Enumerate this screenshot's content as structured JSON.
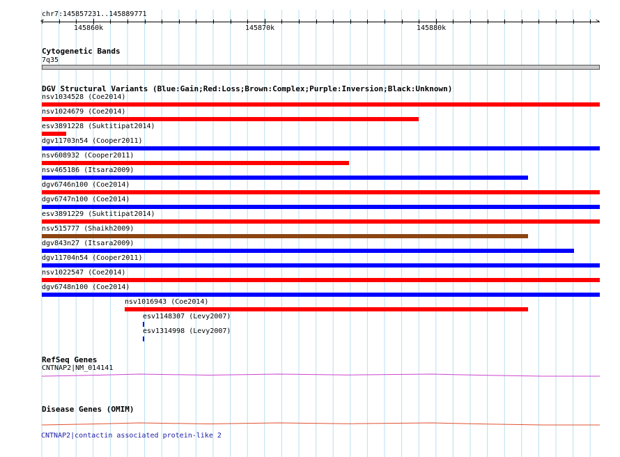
{
  "ruler": {
    "location": "chr7:145857231..145889771",
    "tick_labels": [
      "145860k",
      "145870k",
      "145880k"
    ]
  },
  "cytoband": {
    "title": "Cytogenetic Bands",
    "band": "7q35"
  },
  "dgv": {
    "title": "DGV Structural Variants (Blue:Gain;Red:Loss;Brown:Complex;Purple:Inversion;Black:Unknown)",
    "colors": {
      "gain": "#0000ff",
      "loss": "#ff0000",
      "complex": "#8b4513",
      "inversion": "#800080",
      "unknown": "#000000"
    },
    "variants": [
      {
        "label": "nsv1034528 (Coe2014)",
        "type": "loss"
      },
      {
        "label": "nsv1024679 (Coe2014)",
        "type": "loss"
      },
      {
        "label": "esv3891228 (Suktitipat2014)",
        "type": "loss"
      },
      {
        "label": "dgv11703n54 (Cooper2011)",
        "type": "gain"
      },
      {
        "label": "nsv608932 (Cooper2011)",
        "type": "loss"
      },
      {
        "label": "nsv465186 (Itsara2009)",
        "type": "gain"
      },
      {
        "label": "dgv6746n100 (Coe2014)",
        "type": "loss"
      },
      {
        "label": "dgv6747n100 (Coe2014)",
        "type": "gain"
      },
      {
        "label": "esv3891229 (Suktitipat2014)",
        "type": "loss"
      },
      {
        "label": "nsv515777 (Shaikh2009)",
        "type": "complex"
      },
      {
        "label": "dgv843n27 (Itsara2009)",
        "type": "gain"
      },
      {
        "label": "dgv11704n54 (Cooper2011)",
        "type": "gain"
      },
      {
        "label": "nsv1022547 (Coe2014)",
        "type": "loss"
      },
      {
        "label": "dgv6748n100 (Coe2014)",
        "type": "gain"
      },
      {
        "label": "nsv1016943 (Coe2014)",
        "type": "loss"
      },
      {
        "label": "esv1148307 (Levy2007)",
        "type": "gain"
      },
      {
        "label": "esv1314998 (Levy2007)",
        "type": "gain"
      }
    ]
  },
  "refseq": {
    "title": "RefSeq Genes",
    "gene": "CNTNAP2|NM_014141",
    "color": "#cc44cc"
  },
  "disease": {
    "title": "Disease Genes (OMIM)",
    "gene": "CNTNAP2|contactin associated protein-like 2",
    "color": "#e05030"
  }
}
